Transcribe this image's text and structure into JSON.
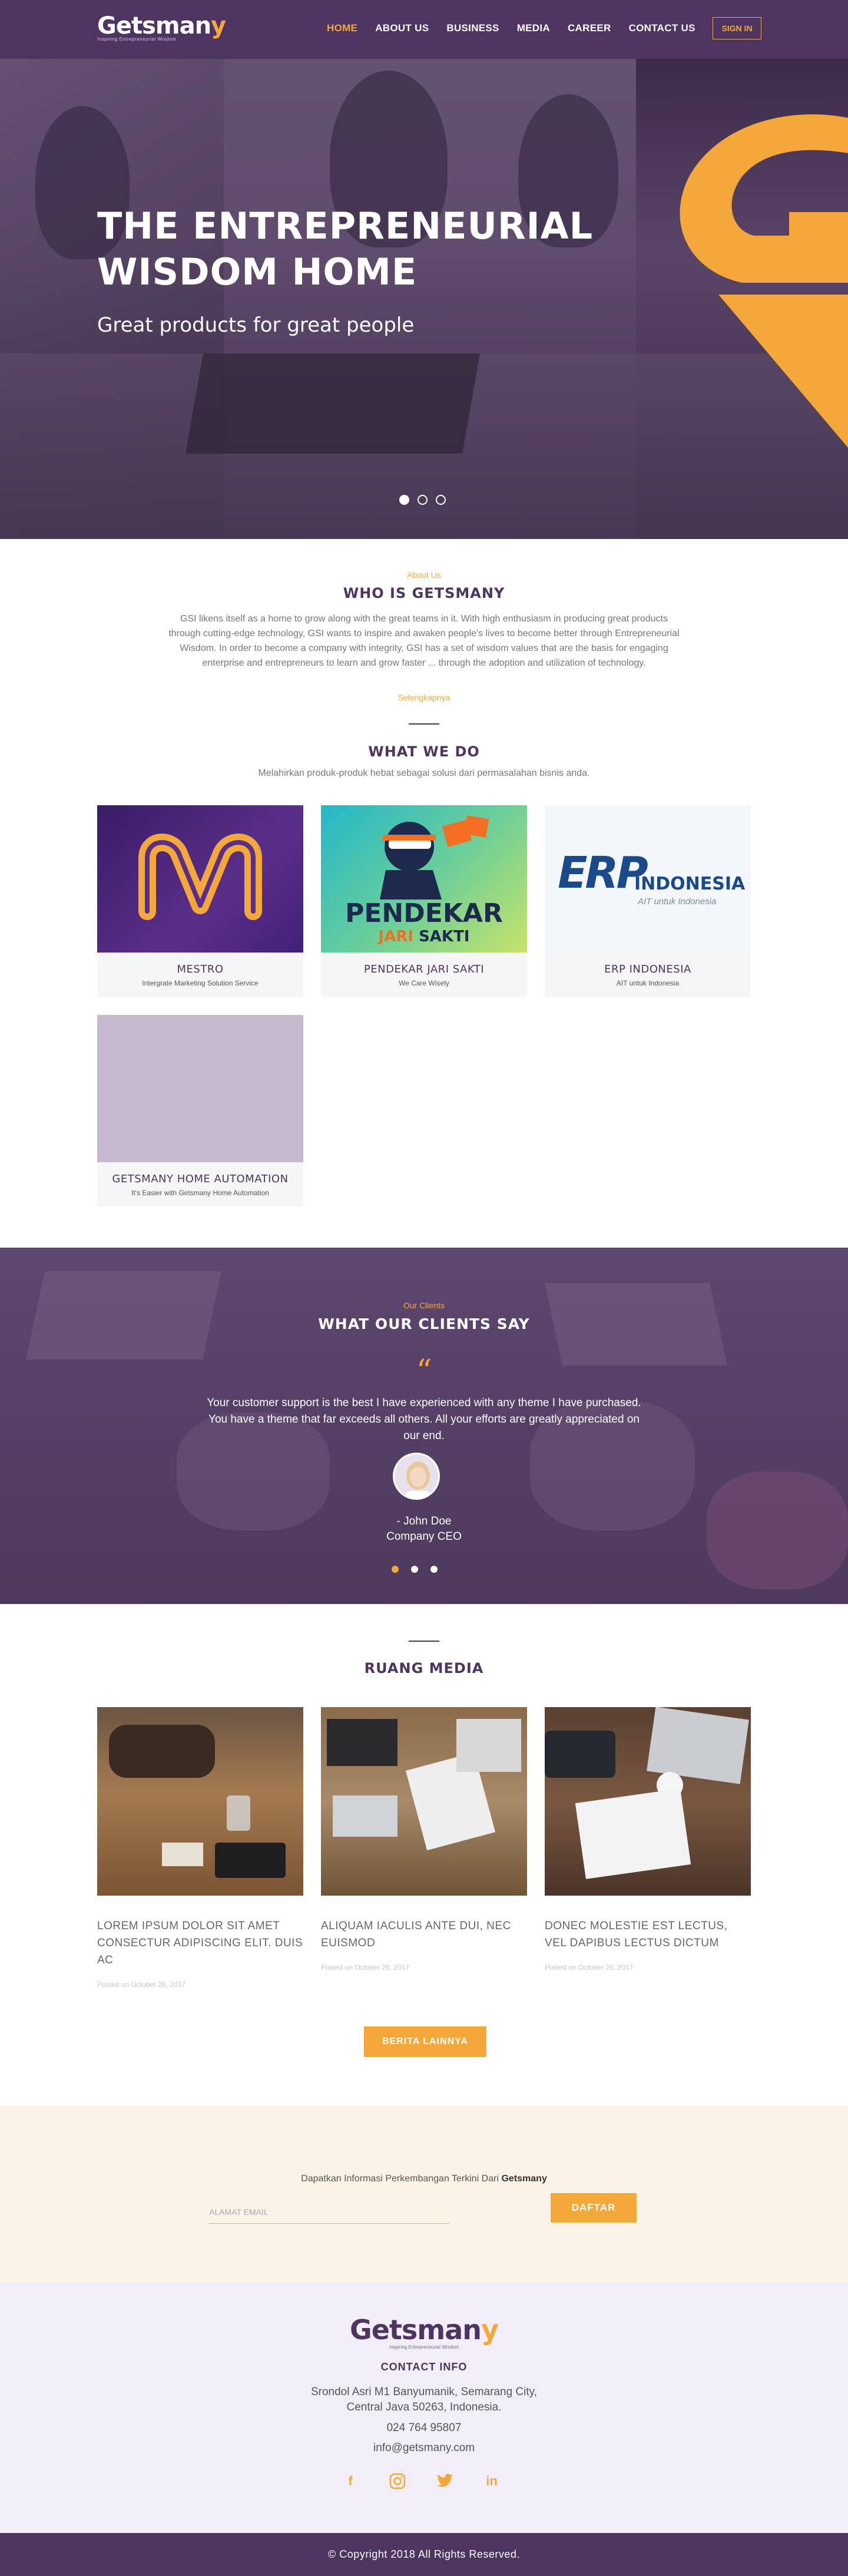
{
  "brand": {
    "logo_text": "Getsmany",
    "tagline": "Inspiring Entrepreneurial Wisdom",
    "accent": "#f4a83a",
    "primary": "#4e3460"
  },
  "nav": {
    "items": [
      {
        "label": "HOME",
        "active": true
      },
      {
        "label": "ABOUT US"
      },
      {
        "label": "BUSINESS"
      },
      {
        "label": "MEDIA"
      },
      {
        "label": "CAREER"
      },
      {
        "label": "CONTACT US"
      }
    ],
    "signin": "SIGN IN"
  },
  "hero": {
    "title_line1": "THE ENTREPRENEURIAL",
    "title_line2": "WISDOM HOME",
    "subtitle": "Great products for great people",
    "slides": 3,
    "active_slide": 1
  },
  "about": {
    "kicker": "About Us",
    "title": "WHO IS GETSMANY",
    "body": "GSI likens itself as a home to grow along with the great teams in it. With high enthusiasm in producing great products through cutting-edge technology, GSI wants to inspire and awaken people's lives to become better through Entrepreneurial Wisdom. In order to become a company with integrity, GSI has a set of wisdom values that are the basis for engaging enterprise and entrepreneurs to learn and grow faster ... through the adoption and utilization of technology.",
    "more_link": "Selengkapnya"
  },
  "business": {
    "title": "WHAT WE DO",
    "subtitle": "Melahirkan produk-produk hebat sebagai solusi dari permasalahan bisnis anda.",
    "cards": [
      {
        "name": "MESTRO",
        "desc": "Intergrate Marketing Solution Service",
        "logo_text": ""
      },
      {
        "name": "PENDEKAR JARI SAKTI",
        "desc": "We Care Wisely",
        "logo_text1": "PENDEKAR",
        "logo_text2": "JARI",
        "logo_text3": "SAKTI"
      },
      {
        "name": "ERP INDONESIA",
        "desc": "AIT untuk Indonesia",
        "logo_text1": "ERP",
        "logo_text2": "INDONESIA",
        "logo_text3": "AIT untuk Indonesia"
      },
      {
        "name": "GETSMANY HOME AUTOMATION",
        "desc": "It's Easier with Getsmany Home Automation"
      }
    ]
  },
  "clients": {
    "kicker": "Our Clients",
    "title": "WHAT OUR CLIENTS SAY",
    "quote_mark": "“",
    "text": "Your customer support is the best I have experienced with any theme I have purchased. You have a theme that far exceeds all others. All your efforts are greatly appreciated on our end.",
    "author": "- John Doe",
    "role": "Company CEO",
    "slides": 3,
    "active_slide": 1
  },
  "media": {
    "title": "RUANG MEDIA",
    "posts": [
      {
        "title": "LOREM IPSUM DOLOR SIT AMET CONSECTUR ADIPISCING ELIT. DUIS AC",
        "date": "Posted on October 26, 2017"
      },
      {
        "title": "ALIQUAM IACULIS ANTE DUI, NEC EUISMOD",
        "date": "Posted on October 26, 2017"
      },
      {
        "title": "DONEC MOLESTIE EST LECTUS, VEL DAPIBUS LECTUS DICTUM",
        "date": "Posted on October 26, 2017"
      }
    ],
    "more_button": "BERITA LAINNYA"
  },
  "newsletter": {
    "text_prefix": "Dapatkan Informasi Perkembangan Terkini Dari",
    "text_brand": "Getsmany",
    "placeholder": "ALAMAT EMAIL",
    "button": "DAFTAR"
  },
  "footer": {
    "logo_text": "Getsmany",
    "tagline": "Inspiring Entrepreneurial Wisdom",
    "contact_title": "CONTACT INFO",
    "address_line1": "Srondol Asri M1  Banyumanik, Semarang City,",
    "address_line2": "Central Java 50263, Indonesia.",
    "phone": "024 764 95807",
    "email": "info@getsmany.com",
    "social": [
      {
        "icon": "facebook-icon",
        "glyph": "f"
      },
      {
        "icon": "instagram-icon",
        "glyph": ""
      },
      {
        "icon": "twitter-icon",
        "glyph": ""
      },
      {
        "icon": "linkedin-icon",
        "glyph": "in"
      }
    ],
    "copyright": "© Copyright 2018 All Rights Reserved."
  }
}
